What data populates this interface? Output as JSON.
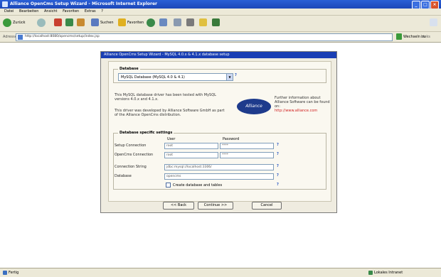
{
  "window": {
    "title": "Alliance OpenCms Setup Wizard - Microsoft Internet Explorer"
  },
  "menu": [
    "Datei",
    "Bearbeiten",
    "Ansicht",
    "Favoriten",
    "Extras",
    "?"
  ],
  "toolbar": {
    "back": "Zurück",
    "search": "Suchen",
    "favorites": "Favoriten"
  },
  "address": {
    "label": "Adresse",
    "url": "http://localhost:8080/opencms/setup/index.jsp",
    "go": "Wechseln zu",
    "links": "Links"
  },
  "dialog": {
    "title": "Alliance OpenCms Setup Wizard - MySQL 4.0.x & 4.1.x database setup",
    "database_group": "Database",
    "database_value": "MySQL Database (MySQL 4.0 & 4.1)",
    "description_1": "This MySQL database driver has been tested with MySQL versions 4.0.x and 4.1.x.",
    "description_2": "This driver was developed by Alliance Software GmbH as part of the Alliance OpenCms distribution.",
    "logo": "Alliance",
    "company_text": "Further information about Alliance Software can be found on:",
    "company_link": "http://www.alliance.com",
    "settings_group": "Database specific settings",
    "col_user": "User",
    "col_password": "Password",
    "rows": [
      {
        "label": "Setup Connection",
        "user": "root",
        "password": "****"
      },
      {
        "label": "OpenCms Connection",
        "user": "root",
        "password": "****"
      },
      {
        "label": "Connection String",
        "value": "jdbc:mysql://localhost:3306/"
      },
      {
        "label": "Database",
        "value": "opencms"
      }
    ],
    "create_label": "Create database and tables",
    "back_button": "<< Back",
    "continue_button": "Continue >>",
    "cancel_button": "Cancel"
  },
  "status": {
    "left": "Fertig",
    "right": "Lokales Intranet"
  },
  "colors": {
    "accent": "#1a3fb4",
    "dialog_bg": "#efece0"
  }
}
